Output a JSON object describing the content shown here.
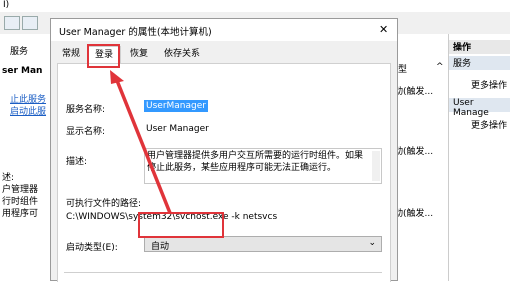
{
  "bg": {
    "menu_text": "I)",
    "left_items": [
      "服务",
      "ser Man",
      "止此服务",
      "启动此服",
      "述:",
      "户管理器",
      "行时组件",
      "用程序可"
    ],
    "status_col": [
      "型",
      "^",
      "动(触发...",
      "动(触发...",
      "动(触发..."
    ],
    "right_header": "操作",
    "right_items": [
      "服务",
      "更多操作",
      "User Manage",
      "更多操作"
    ]
  },
  "dialog": {
    "title": "User Manager 的属性(本地计算机)",
    "close": "✕",
    "tabs": [
      "常规",
      "登录",
      "恢复",
      "依存关系"
    ],
    "service_name_label": "服务名称:",
    "service_name_value": "UserManager",
    "display_name_label": "显示名称:",
    "display_name_value": "User Manager",
    "desc_label": "描述:",
    "desc_value": "用户管理器提供多用户交互所需要的运行时组件。如果停止此服务，某些应用程序可能无法正确运行。",
    "exe_label": "可执行文件的路径:",
    "exe_value": "C:\\WINDOWS\\system32\\svchost.exe -k netsvcs",
    "startup_label": "启动类型(E):",
    "startup_value": "自动"
  },
  "colors": {
    "highlight": "#e0343a",
    "selection": "#3399ff"
  }
}
